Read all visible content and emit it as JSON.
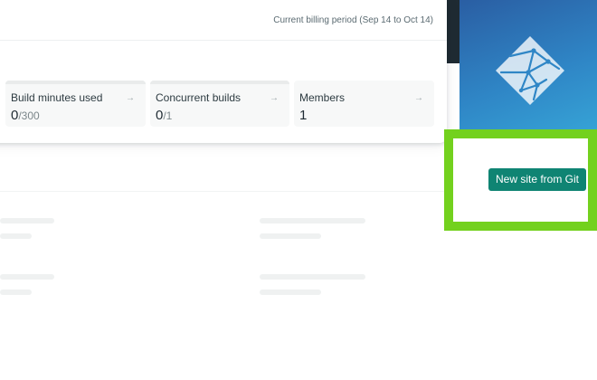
{
  "usage": {
    "billing_period": "Current billing period (Sep 14 to Oct 14)",
    "stats": [
      {
        "label": "Build minutes used",
        "value": "0",
        "limit": "/300",
        "arrow": "→"
      },
      {
        "label": "Concurrent builds",
        "value": "0",
        "limit": "/1",
        "arrow": "→"
      },
      {
        "label": "Members",
        "value": "1",
        "limit": "",
        "arrow": "→"
      }
    ]
  },
  "sidebar": {
    "logo_icon": "netlify-logo-icon",
    "new_site_button": "New site from Git"
  },
  "colors": {
    "highlight": "#73d11e",
    "button": "#0f8473",
    "promo_gradient": [
      "#2a5ea3",
      "#37a7d8"
    ]
  }
}
